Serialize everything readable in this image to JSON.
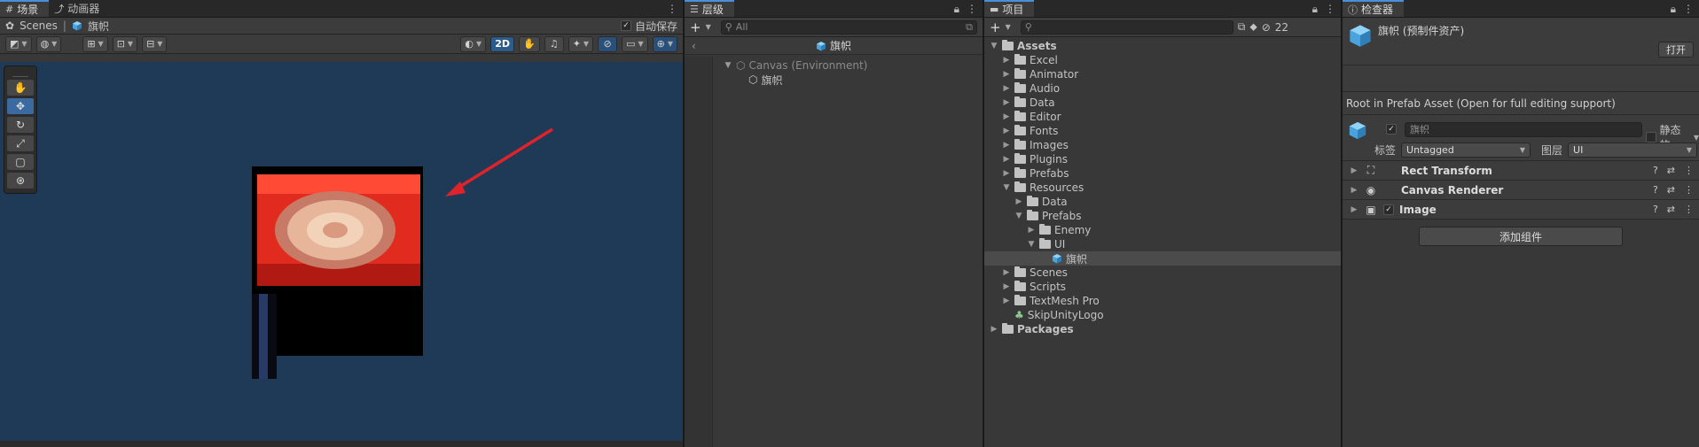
{
  "scene": {
    "tabs": [
      {
        "label": "场景",
        "active": true
      },
      {
        "label": "动画器",
        "active": false
      }
    ],
    "crumb_scenes": "Scenes",
    "crumb_prefab": "旗帜",
    "autosave_label": "自动保存",
    "btn_2d": "2D"
  },
  "hierarchy": {
    "tab": "层级",
    "search_placeholder": "All",
    "scene_title": "旗帜",
    "items": [
      {
        "label": "Canvas (Environment)",
        "dim": true
      },
      {
        "label": "旗帜",
        "dim": false
      }
    ]
  },
  "project": {
    "tab": "项目",
    "hidden_count": "22",
    "tree": [
      {
        "label": "Assets",
        "expanded": true
      },
      {
        "label": "Excel"
      },
      {
        "label": "Animator"
      },
      {
        "label": "Audio"
      },
      {
        "label": "Data"
      },
      {
        "label": "Editor"
      },
      {
        "label": "Fonts"
      },
      {
        "label": "Images"
      },
      {
        "label": "Plugins"
      },
      {
        "label": "Prefabs"
      },
      {
        "label": "Resources",
        "expanded": true
      },
      {
        "label": "Data"
      },
      {
        "label": "Prefabs",
        "expanded": true
      },
      {
        "label": "Enemy"
      },
      {
        "label": "UI",
        "expanded": true
      },
      {
        "label": "旗帜"
      },
      {
        "label": "Scenes"
      },
      {
        "label": "Scripts"
      },
      {
        "label": "TextMesh Pro"
      },
      {
        "label": "SkipUnityLogo"
      },
      {
        "label": "Packages"
      }
    ]
  },
  "inspector": {
    "tab": "检查器",
    "title": "旗帜 (预制件资产)",
    "open_label": "打开",
    "prefab_message": "Root in Prefab Asset (Open for full editing support)",
    "name_value": "旗帜",
    "static_label": "静态的",
    "tag_label": "标签",
    "tag_value": "Untagged",
    "layer_label": "图层",
    "layer_value": "UI",
    "components": [
      {
        "label": "Rect Transform",
        "icon": "rect-transform-icon"
      },
      {
        "label": "Canvas Renderer",
        "icon": "eye-icon"
      },
      {
        "label": "Image",
        "icon": "image-icon"
      }
    ],
    "add_component": "添加组件"
  },
  "colors": {
    "accent": "#4a90d9",
    "viewport_bg": "#1f3a57",
    "arrow": "#e0232b",
    "flag_red": "#e02b1e",
    "prefab_cube": "#5ab4e8"
  }
}
